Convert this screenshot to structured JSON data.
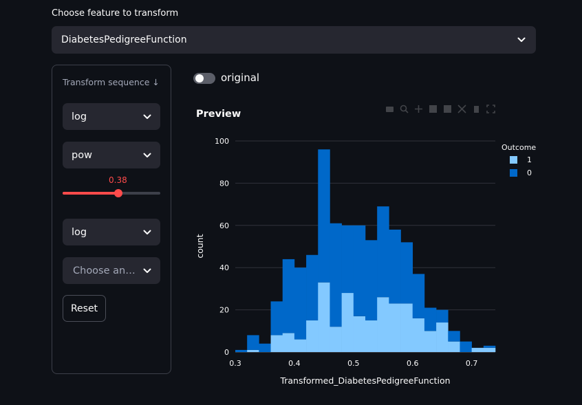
{
  "feature": {
    "label": "Choose feature to transform",
    "selected": "DiabetesPedigreeFunction"
  },
  "transform": {
    "title": "Transform sequence ↓",
    "steps": [
      "log",
      "pow",
      "log"
    ],
    "slider_value": "0.38",
    "slider_fraction": 0.57,
    "placeholder": "Choose an…",
    "reset_label": "Reset"
  },
  "toggle": {
    "label": "original",
    "on": false
  },
  "preview": {
    "title": "Preview"
  },
  "colors": {
    "series1": "#83c9ff",
    "series0": "#0068c9",
    "slider": "#ff4b4b"
  },
  "chart_data": {
    "type": "bar",
    "stacked": true,
    "xlabel": "Transformed_DiabetesPedigreeFunction",
    "ylabel": "count",
    "xlim": [
      0.3,
      0.74
    ],
    "ylim": [
      0,
      100
    ],
    "xticks": [
      0.3,
      0.4,
      0.5,
      0.6,
      0.7
    ],
    "yticks": [
      0,
      20,
      40,
      60,
      80,
      100
    ],
    "bin_width": 0.02,
    "bin_starts": [
      0.3,
      0.32,
      0.34,
      0.36,
      0.38,
      0.4,
      0.42,
      0.44,
      0.46,
      0.48,
      0.5,
      0.52,
      0.54,
      0.56,
      0.58,
      0.6,
      0.62,
      0.64,
      0.66,
      0.68,
      0.7,
      0.72
    ],
    "legend": {
      "title": "Outcome",
      "position": "top-right"
    },
    "series": [
      {
        "name": "1",
        "values": [
          0,
          1,
          0,
          8,
          9,
          6,
          15,
          33,
          12,
          28,
          17,
          15,
          26,
          23,
          23,
          16,
          10,
          14,
          5,
          0,
          2,
          2
        ]
      },
      {
        "name": "0",
        "values": [
          1,
          7,
          4,
          16,
          35,
          34,
          31,
          63,
          49,
          32,
          43,
          38,
          43,
          35,
          29,
          21,
          11,
          6,
          5,
          5,
          0,
          1
        ]
      }
    ]
  }
}
